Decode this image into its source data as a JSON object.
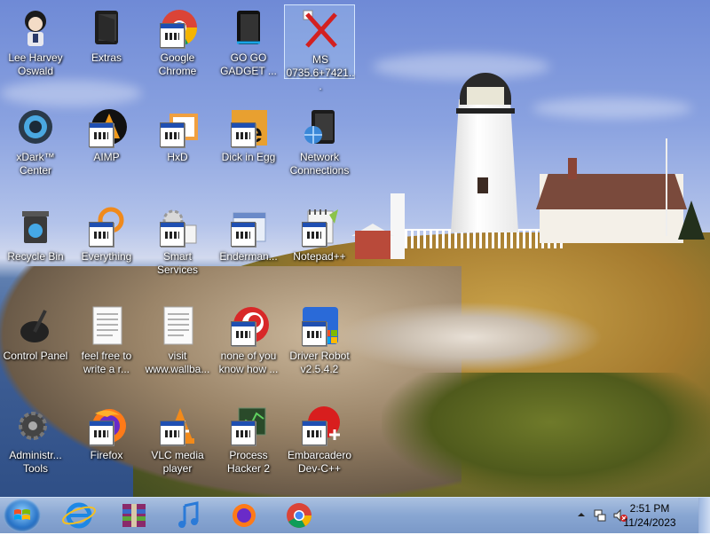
{
  "desktop": {
    "icons": [
      {
        "label": "Lee Harvey Oswald"
      },
      {
        "label": "Extras"
      },
      {
        "label": "Google Chrome"
      },
      {
        "label": "GO GO GADGET ..."
      },
      {
        "label": "MS 0735.6+7421..."
      },
      {
        "label": "xDark™ Center"
      },
      {
        "label": "AIMP"
      },
      {
        "label": "HxD"
      },
      {
        "label": "Dick in Egg"
      },
      {
        "label": "Network Connections"
      },
      {
        "label": "Recycle Bin"
      },
      {
        "label": "Everything"
      },
      {
        "label": "Smart Services"
      },
      {
        "label": "Enderman..."
      },
      {
        "label": "Notepad++"
      },
      {
        "label": "Control Panel"
      },
      {
        "label": "feel free to write a r..."
      },
      {
        "label": "visit www.wallba..."
      },
      {
        "label": "none of you know how ..."
      },
      {
        "label": "Driver Robot v2.5.4.2"
      },
      {
        "label": "Administr... Tools"
      },
      {
        "label": "Firefox"
      },
      {
        "label": "VLC media player"
      },
      {
        "label": "Process Hacker 2"
      },
      {
        "label": "Embarcadero Dev-C++"
      }
    ]
  },
  "taskbar": {
    "pinned": [
      "start-button",
      "internet-explorer",
      "winrar",
      "itunes",
      "firefox",
      "google-chrome"
    ],
    "clock": {
      "time": "2:51 PM",
      "date": "11/24/2023"
    }
  }
}
